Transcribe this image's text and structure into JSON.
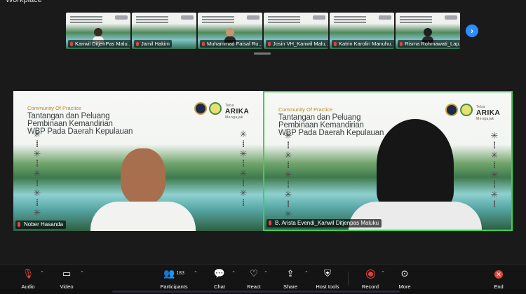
{
  "window": {
    "title": "Workplace"
  },
  "gallery": {
    "thumbnails": [
      {
        "name": "Kanwil DitjenPas Malu...",
        "has_person": true
      },
      {
        "name": "Jamil Hakim",
        "has_person": false
      },
      {
        "name": "Muhammad Faisal Ru...",
        "has_person": true
      },
      {
        "name": "Josin VH_Kanwil Malu...",
        "has_person": false
      },
      {
        "name": "Katrin Karolin Manuhu...",
        "has_person": false
      },
      {
        "name": "Risma Rohmawati_Lap...",
        "has_person": true
      }
    ],
    "next_icon": "chevron-right-icon"
  },
  "slide": {
    "subtitle": "Community Of Practice",
    "title": "Tantangan dan Peluang\nPembinaan Kemandirian\nWBP Pada Daerah Kepulauan",
    "brand": "ARIKA",
    "brand_top": "Teba",
    "brand_sub": "Mengajak"
  },
  "participants": [
    {
      "name": "Nober Hasanda",
      "active_speaker": false
    },
    {
      "name": "B. Arista Evendi_Kanwil Ditjenpas Maluku",
      "active_speaker": true
    }
  ],
  "toolbar": {
    "audio": {
      "label": "Audio",
      "icon": "microphone-muted-icon"
    },
    "video": {
      "label": "Video",
      "icon": "video-camera-icon"
    },
    "participants": {
      "label": "Participants",
      "count": "183",
      "icon": "people-icon"
    },
    "chat": {
      "label": "Chat",
      "icon": "chat-bubble-icon"
    },
    "react": {
      "label": "React",
      "icon": "heart-icon"
    },
    "share": {
      "label": "Share",
      "icon": "share-screen-icon"
    },
    "host_tools": {
      "label": "Host tools",
      "icon": "shield-icon"
    },
    "record": {
      "label": "Record",
      "icon": "record-icon"
    },
    "more": {
      "label": "More",
      "icon": "more-dots-icon"
    },
    "end": {
      "label": "End",
      "icon": "close-icon"
    }
  },
  "colors": {
    "active_border": "#39d353",
    "accent": "#2d8cff",
    "danger": "#e4433b"
  }
}
